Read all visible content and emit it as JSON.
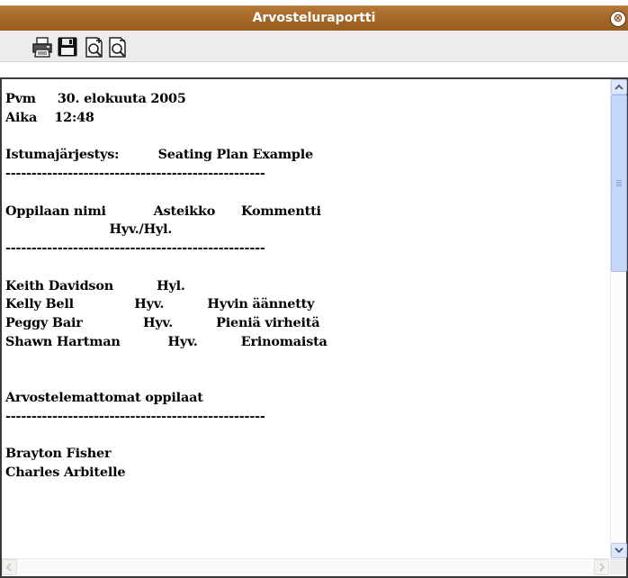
{
  "window": {
    "title": "Arvosteluraportti"
  },
  "icons": {
    "close": "close-icon",
    "print": "printer-icon",
    "save": "floppy-disk-icon",
    "zoom_in": "zoom-in-page-icon",
    "zoom_out": "zoom-out-page-icon"
  },
  "report": {
    "lines": [
      "Pvm     30. elokuuta 2005",
      "Aika    12:48",
      "",
      "Istumajärjestys:         Seating Plan Example",
      "--------------------------------------------------",
      "",
      "Oppilaan nimi           Asteikko      Kommentti",
      "                        Hyv./Hyl.",
      "--------------------------------------------------",
      "",
      "Keith Davidson          Hyl.",
      "Kelly Bell              Hyv.          Hyvin äännetty",
      "Peggy Bair              Hyv.          Pieniä virheitä",
      "Shawn Hartman           Hyv.          Erinomaista",
      "",
      "",
      "Arvostelemattomat oppilaat",
      "--------------------------------------------------",
      "",
      "Brayton Fisher",
      "Charles Arbitelle"
    ]
  },
  "colors": {
    "titlebar": "#a56828",
    "title_text": "#ffffff",
    "scrollbar": "#c6d6fb"
  }
}
